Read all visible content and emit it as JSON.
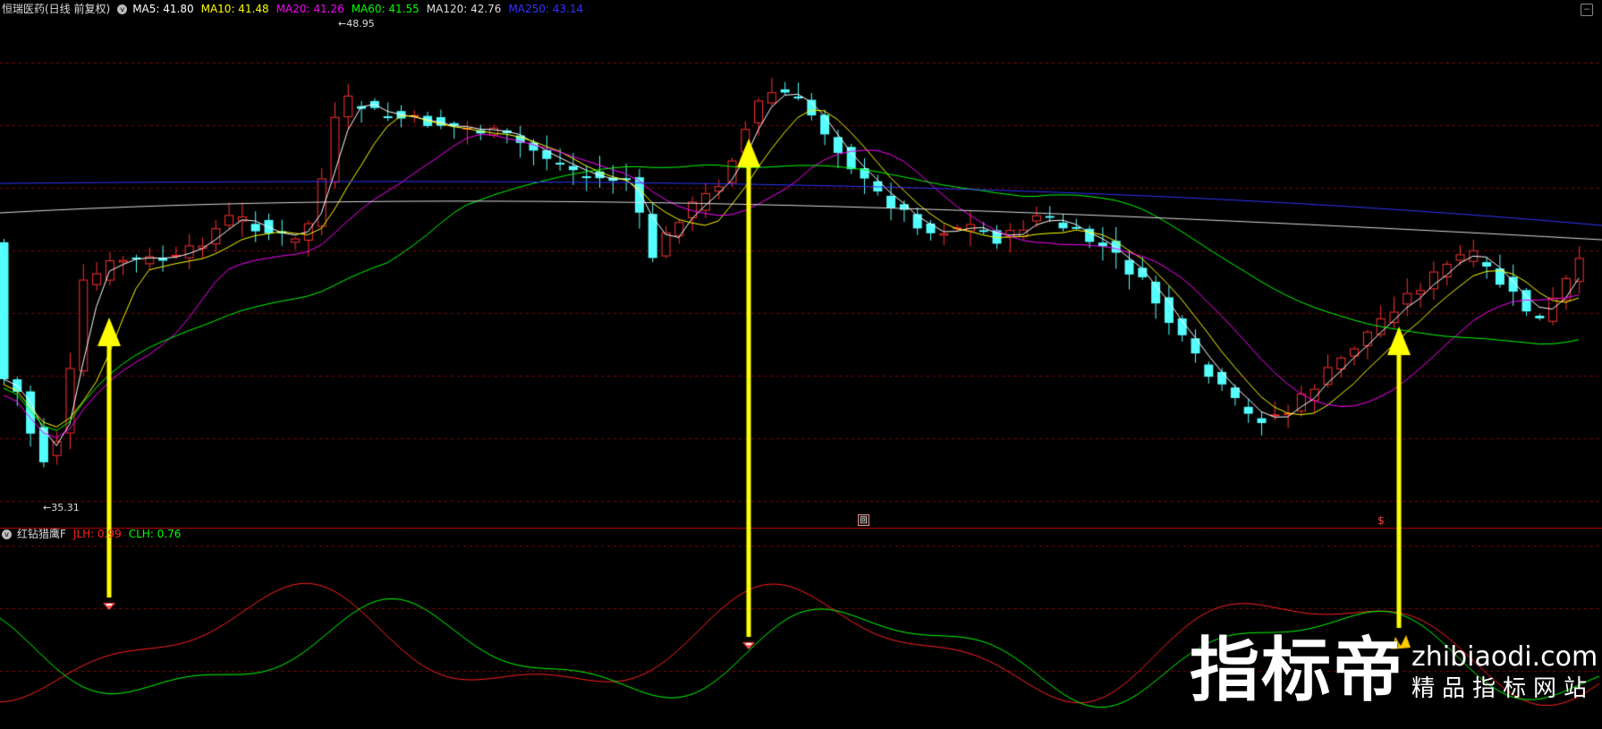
{
  "main_panel": {
    "stock_name": "恒瑞医药(日线 前复权)",
    "mas": [
      {
        "label": "MA5: 41.80",
        "color": "#ffffff"
      },
      {
        "label": "MA10: 41.48",
        "color": "#ffff00"
      },
      {
        "label": "MA20: 41.26",
        "color": "#ff00ff"
      },
      {
        "label": "MA60: 41.55",
        "color": "#00ff00"
      },
      {
        "label": "MA120: 42.76",
        "color": "#dddddd"
      },
      {
        "label": "MA250: 43.14",
        "color": "#3333ff"
      }
    ],
    "high_label": "48.95",
    "low_label": "35.31"
  },
  "sub_panel": {
    "indicator_name": "红钻猎鹰F",
    "jlh_label": "JLH: 0.99",
    "jlh_color": "#ff2020",
    "clh_label": "CLH: 0.76",
    "clh_color": "#00ff00"
  },
  "markers": {
    "square": "回",
    "dollar": "$"
  },
  "watermark": {
    "main": "指标帝",
    "url": "zhibiaodi.com",
    "sub": "精品指标网站"
  },
  "icons": [
    "toggle-circle-icon",
    "corner-button-icon",
    "diamond-icon",
    "crown-icon",
    "arrow-icon"
  ],
  "colors": {
    "up": "#ff3030",
    "down": "#54ffff",
    "arrow": "#ffff00",
    "grid": "#8b0000"
  }
}
